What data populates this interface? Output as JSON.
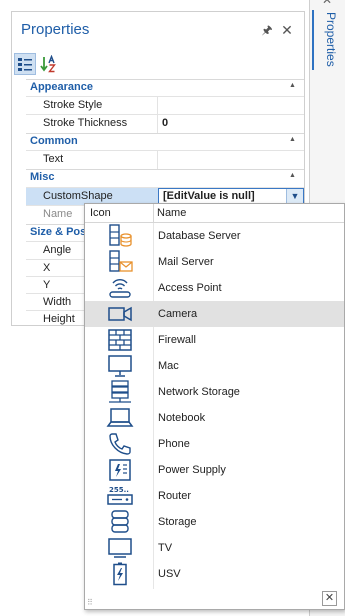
{
  "side_tab": {
    "label": "Properties"
  },
  "panel": {
    "title": "Properties",
    "pin_glyph": "🖈",
    "close_glyph": "✕"
  },
  "toolbar": {
    "categorized_icon": "categorized-list-icon",
    "alphabetical_icon": "sort-az-icon"
  },
  "categories": [
    {
      "label": "Appearance",
      "properties": [
        {
          "name": "Stroke Style",
          "value": ""
        },
        {
          "name": "Stroke Thickness",
          "value": "0"
        }
      ]
    },
    {
      "label": "Common",
      "properties": [
        {
          "name": "Text",
          "value": ""
        }
      ]
    },
    {
      "label": "Misc",
      "properties": [
        {
          "name": "CustomShape",
          "value": "[EditValue is null]"
        },
        {
          "name": "Name",
          "value": ""
        }
      ]
    },
    {
      "label": "Size & Pos",
      "properties": [
        {
          "name": "Angle",
          "value": ""
        },
        {
          "name": "X",
          "value": ""
        },
        {
          "name": "Y",
          "value": ""
        },
        {
          "name": "Width",
          "value": ""
        },
        {
          "name": "Height",
          "value": ""
        }
      ]
    }
  ],
  "dropdown": {
    "columns": {
      "icon": "Icon",
      "name": "Name"
    },
    "highlighted": "Camera",
    "items": [
      {
        "name": "Database Server",
        "icon": "database-server-icon"
      },
      {
        "name": "Mail Server",
        "icon": "mail-server-icon"
      },
      {
        "name": "Access Point",
        "icon": "access-point-icon"
      },
      {
        "name": "Camera",
        "icon": "camera-icon"
      },
      {
        "name": "Firewall",
        "icon": "firewall-icon"
      },
      {
        "name": "Mac",
        "icon": "mac-icon"
      },
      {
        "name": "Network Storage",
        "icon": "network-storage-icon"
      },
      {
        "name": "Notebook",
        "icon": "notebook-icon"
      },
      {
        "name": "Phone",
        "icon": "phone-icon"
      },
      {
        "name": "Power Supply",
        "icon": "power-supply-icon"
      },
      {
        "name": "Router",
        "icon": "router-icon"
      },
      {
        "name": "Storage",
        "icon": "storage-icon"
      },
      {
        "name": "TV",
        "icon": "tv-icon"
      },
      {
        "name": "USV",
        "icon": "usv-icon"
      }
    ],
    "router_badge": "255..",
    "close_glyph": "✕"
  },
  "colors": {
    "accent": "#1f5ea8",
    "icon_blue": "#1f4e8a",
    "mail_orange": "#e8912d",
    "selection": "#cce0f5",
    "highlight": "#e1e1e1"
  }
}
